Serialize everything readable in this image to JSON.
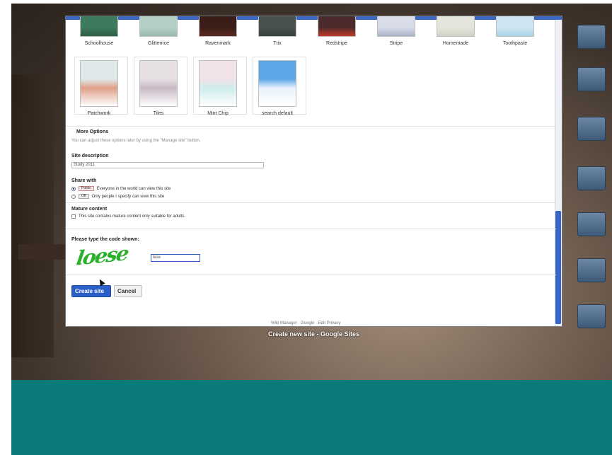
{
  "themes_row1": [
    {
      "label": "Schoolhouse",
      "color": "#3e7a5c",
      "accent": "#2f5e47"
    },
    {
      "label": "Glitterrice",
      "color": "#b4cfc4",
      "accent": "#9cbab0"
    },
    {
      "label": "Ravenmark",
      "color": "#3b1d17",
      "accent": "#5a2a20"
    },
    {
      "label": "Trix",
      "color": "#4a5250",
      "accent": "#38403e"
    },
    {
      "label": "Redstripe",
      "color": "#4a2a2a",
      "accent": "#c0392b"
    },
    {
      "label": "Stripe",
      "color": "#d9dde8",
      "accent": "#a9b3c8"
    },
    {
      "label": "Homemade",
      "color": "#e4e6dc",
      "accent": "#cfd2c4"
    },
    {
      "label": "Toothpaste",
      "color": "#cfe6f2",
      "accent": "#a9d1e6"
    }
  ],
  "themes_row2": [
    {
      "label": "Patchwork",
      "color": "#dfe9ea",
      "accent": "#e0a08a"
    },
    {
      "label": "Tiles",
      "color": "#e6dfe4",
      "accent": "#c9b9c4"
    },
    {
      "label": "Mint Chip",
      "color": "#f0e2e6",
      "accent": "#cfecec"
    },
    {
      "label": "search default",
      "color": "#5aa6e6",
      "accent": "#e9f2fb"
    }
  ],
  "more_options": {
    "label": "More Options",
    "note": "You can adjust these options later by using the \"Manage site\" button."
  },
  "site_description": {
    "label": "Site description",
    "value": "Study 2011"
  },
  "share_with": {
    "label": "Share with",
    "options": [
      {
        "badge": "Public",
        "text": "Everyone in the world can view this site",
        "selected": true
      },
      {
        "badge": "Off",
        "text": "Only people I specify can view this site",
        "selected": false
      }
    ]
  },
  "mature_content": {
    "label": "Mature content",
    "text": "This site contains mature content only suitable for adults."
  },
  "captcha": {
    "label": "Please type the code shown:",
    "image_text": "loese",
    "input_value": "lese"
  },
  "buttons": {
    "create": "Create site",
    "cancel": "Cancel"
  },
  "footer_link": "Wiki Manager · Google · Edit Privacy",
  "window_caption": "Create new site - Google Sites",
  "colors": {
    "accent_blue": "#2b5fc8",
    "teal": "#0a7a7a",
    "captcha_green": "#2bb02b"
  }
}
